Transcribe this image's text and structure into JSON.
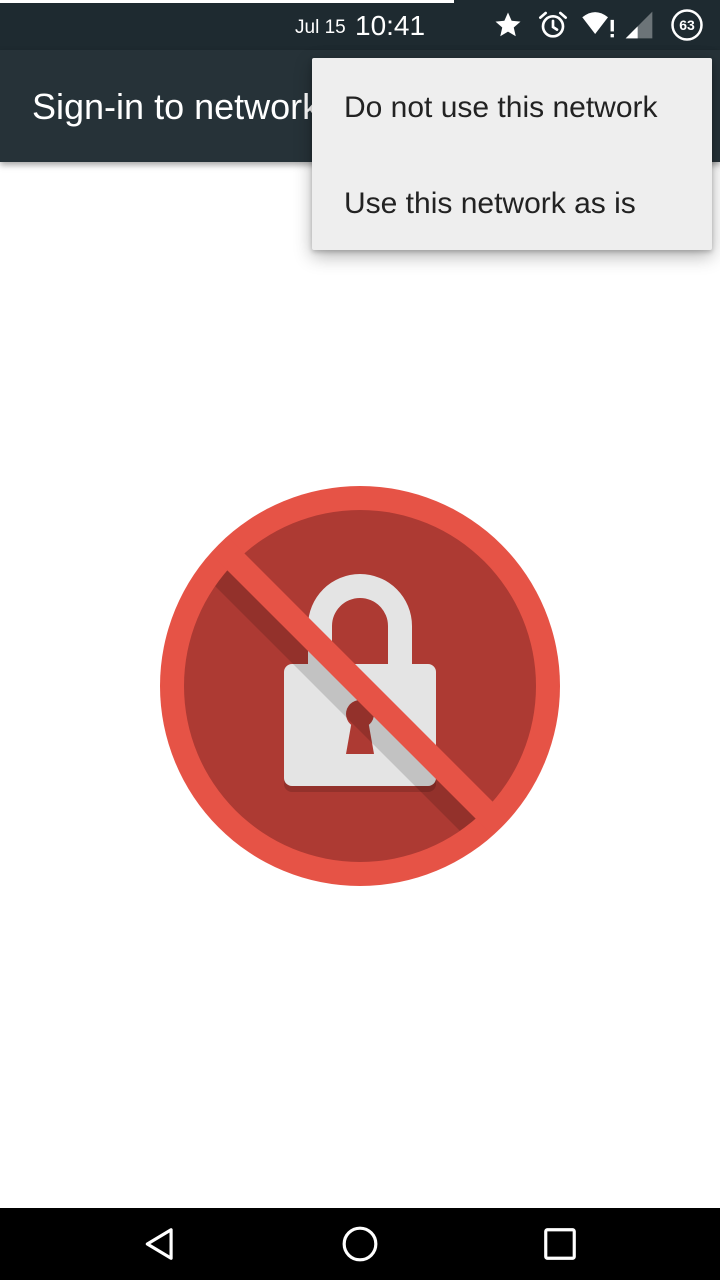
{
  "status_bar": {
    "date": "Jul 15",
    "time": "10:41",
    "battery_level": "63",
    "loading_progress": 0.63,
    "icons": [
      "star-icon",
      "alarm-icon",
      "wifi-alert-icon",
      "cellular-signal-icon",
      "battery-icon"
    ]
  },
  "toolbar": {
    "title": "Sign-in to network"
  },
  "overflow_menu": {
    "items": [
      {
        "label": "Do not use this network"
      },
      {
        "label": "Use this network as is"
      }
    ]
  },
  "content": {
    "icon": "blocked-lock-icon",
    "colors": {
      "ring": "#e65346",
      "disc": "#ad3a33",
      "lock": "#e4e4e4"
    }
  },
  "nav_bar": {
    "icons": [
      "back-icon",
      "home-icon",
      "recents-icon"
    ]
  },
  "colors": {
    "status_bar": "#1e2a30",
    "toolbar": "#263238",
    "menu_background": "#eeeeee"
  }
}
